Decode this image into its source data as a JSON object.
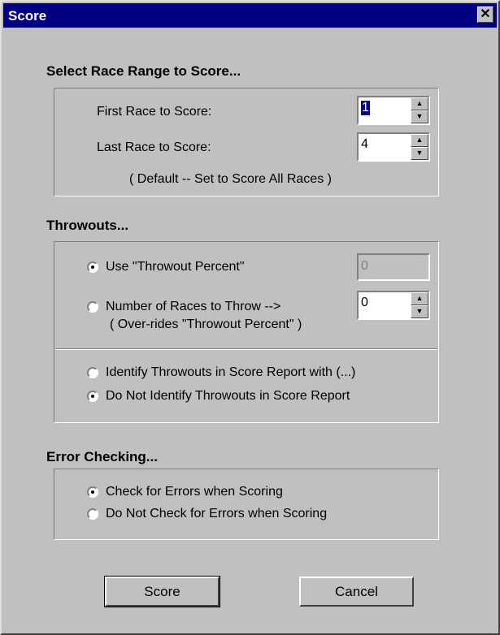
{
  "window": {
    "title": "Score",
    "close_glyph": "✕"
  },
  "race_range": {
    "heading": "Select Race Range to Score...",
    "first_label": "First Race to Score:",
    "first_value": "1",
    "last_label": "Last Race to Score:",
    "last_value": "4",
    "note": "( Default  --  Set to Score All Races )"
  },
  "throwouts": {
    "heading": "Throwouts...",
    "use_percent_label": "Use \"Throwout Percent\"",
    "percent_value": "0",
    "number_label": "Number of Races to Throw  -->",
    "number_sublabel": "( Over-rides \"Throwout Percent\"  )",
    "number_value": "0",
    "identify_label": "Identify Throwouts in Score Report with (...)",
    "no_identify_label": "Do Not Identify Throwouts in Score Report",
    "selected_mode": "use_percent",
    "selected_report": "no_identify"
  },
  "error_checking": {
    "heading": "Error Checking...",
    "check_label": "Check for Errors when Scoring",
    "no_check_label": "Do Not Check for Errors when Scoring",
    "selected": "check"
  },
  "buttons": {
    "score_label": "Score",
    "cancel_label": "Cancel"
  },
  "icons": {
    "spin_up": "▲",
    "spin_down": "▼"
  }
}
